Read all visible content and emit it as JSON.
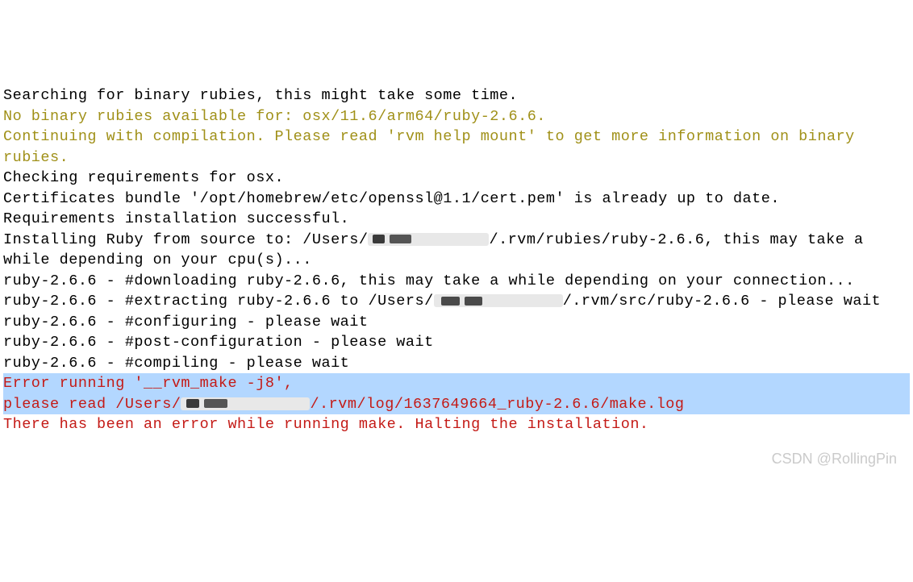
{
  "lines": {
    "l1": "Searching for binary rubies, this might take some time.",
    "l2": "No binary rubies available for: osx/11.6/arm64/ruby-2.6.6.",
    "l3": "Continuing with compilation. Please read 'rvm help mount' to get more information on binary rubies.",
    "l4": "Checking requirements for osx.",
    "l5": "Certificates bundle '/opt/homebrew/etc/openssl@1.1/cert.pem' is already up to date.",
    "l6": "Requirements installation successful.",
    "l7a": "Installing Ruby from source to: /Users/",
    "l7b": "/.rvm/rubies/ruby-2.6.6, this may take a while depending on your cpu(s)...",
    "l8": "ruby-2.6.6 - #downloading ruby-2.6.6, this may take a while depending on your connection...",
    "l9a": "ruby-2.6.6 - #extracting ruby-2.6.6 to /Users/",
    "l9b": "/.rvm/src/ruby-2.6.6 - please wait",
    "l10": "ruby-2.6.6 - #configuring - please wait",
    "l11": "ruby-2.6.6 - #post-configuration - please wait",
    "l12": "ruby-2.6.6 - #compiling - please wait",
    "l13": "Error running '__rvm_make -j8',",
    "l14a": "please read /Users/",
    "l14b": "/.rvm/log/1637649664_ruby-2.6.6/make.log",
    "l15": "",
    "l16": "There has been an error while running make. Halting the installation."
  },
  "watermark": "CSDN @RollingPin"
}
